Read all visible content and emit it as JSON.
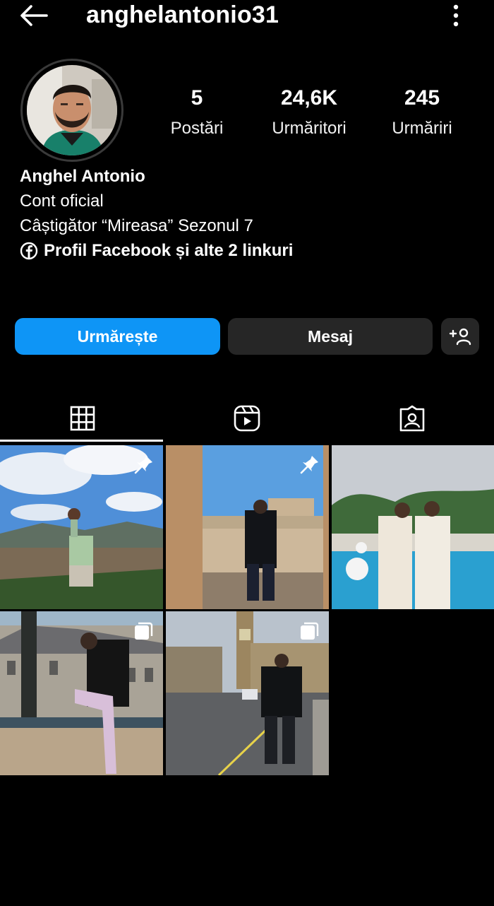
{
  "header": {
    "username": "anghelantonio31",
    "back_icon": "arrow-left-icon",
    "more_icon": "more-vertical-icon"
  },
  "profile": {
    "stats": [
      {
        "value": "5",
        "label": "Postări"
      },
      {
        "value": "24,6K",
        "label": "Urmăritori"
      },
      {
        "value": "245",
        "label": "Urmăriri"
      }
    ],
    "name": "Anghel Antonio",
    "category": "Cont oficial",
    "bio": "Câștigător “Mireasa” Sezonul 7",
    "links": "Profil Facebook și alte 2 linkuri"
  },
  "actions": {
    "follow": "Urmărește",
    "message": "Mesaj",
    "follow_color": "#0e95f6"
  },
  "tabs": [
    "grid-icon",
    "reels-icon",
    "tagged-icon"
  ],
  "posts": [
    {
      "scene": "mountain-city-view",
      "badge": "pin-icon"
    },
    {
      "scene": "monument-courtyard",
      "badge": "pin-icon"
    },
    {
      "scene": "pool-party",
      "badge": ""
    },
    {
      "scene": "castle-courtyard",
      "badge": "carousel-icon"
    },
    {
      "scene": "london-big-ben",
      "badge": "carousel-icon"
    }
  ]
}
